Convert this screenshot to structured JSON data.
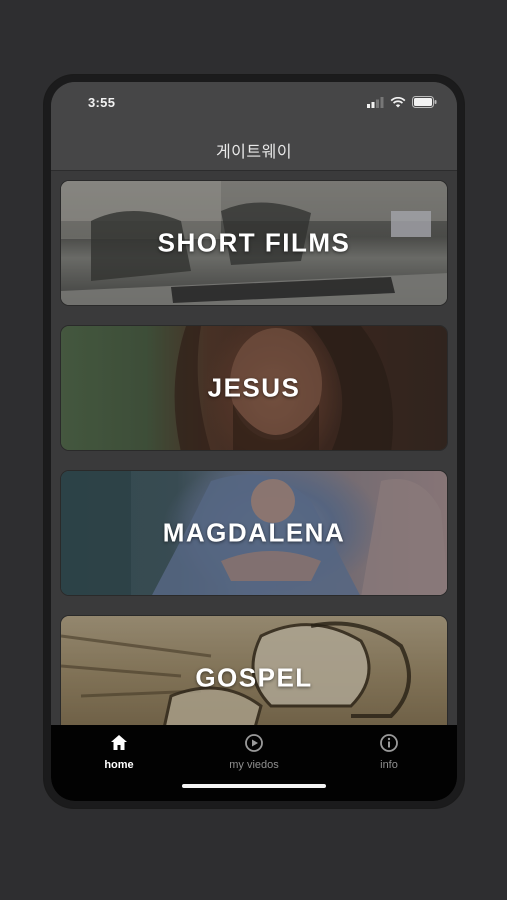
{
  "status_bar": {
    "time": "3:55"
  },
  "header": {
    "title": "게이트웨이"
  },
  "cards": [
    {
      "title": "SHORT FILMS"
    },
    {
      "title": "JESUS"
    },
    {
      "title": "MAGDALENA"
    },
    {
      "title": "GOSPEL"
    }
  ],
  "tab_bar": {
    "tabs": [
      {
        "label": "home",
        "icon": "home-icon",
        "active": true
      },
      {
        "label": "my viedos",
        "icon": "play-icon",
        "active": false
      },
      {
        "label": "info",
        "icon": "info-icon",
        "active": false
      }
    ]
  },
  "colors": {
    "background": "#2e2e30",
    "header": "#464647",
    "tab_bar": "#020202",
    "active_tab": "#ffffff",
    "inactive_tab": "#8f8f8f"
  }
}
